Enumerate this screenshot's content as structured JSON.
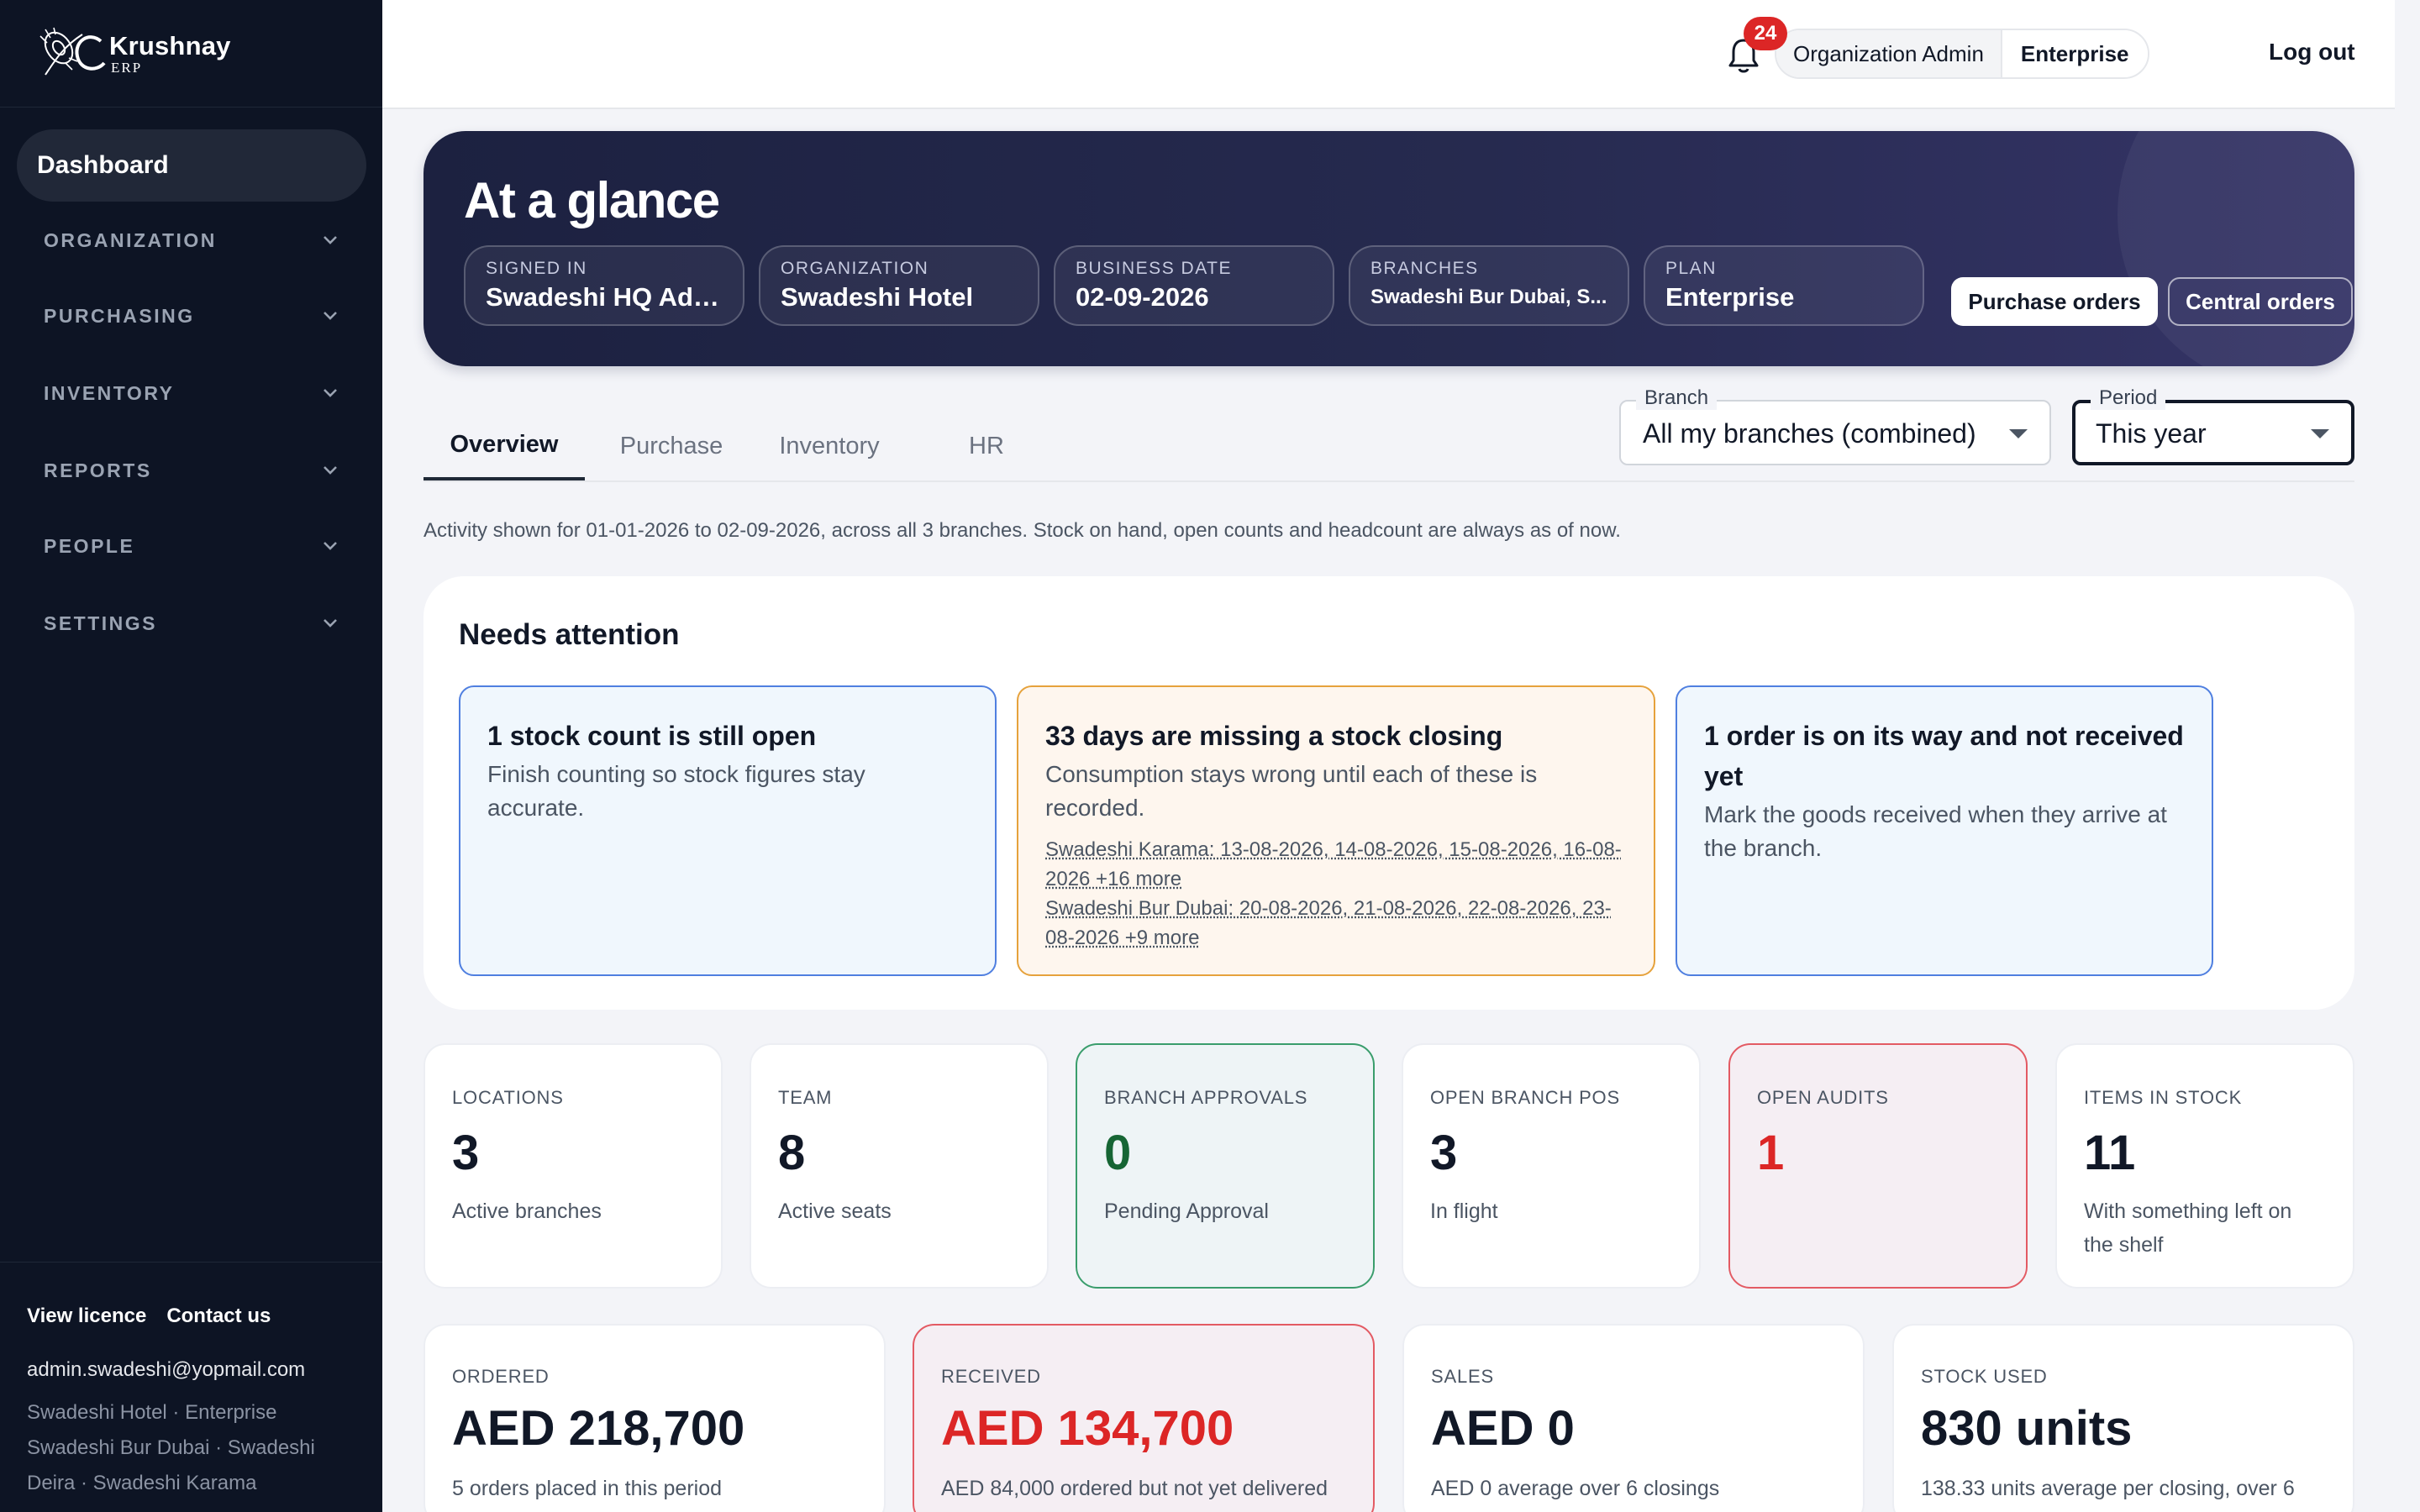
{
  "brand": {
    "name": "Krushnay",
    "sub": "ERP",
    "logo_icon": "peacock-feather-logo-icon"
  },
  "sidebar": {
    "active": "Dashboard",
    "items": [
      {
        "label": "ORGANIZATION"
      },
      {
        "label": "PURCHASING"
      },
      {
        "label": "INVENTORY"
      },
      {
        "label": "REPORTS"
      },
      {
        "label": "PEOPLE"
      },
      {
        "label": "SETTINGS"
      }
    ],
    "footer": {
      "view_licence": "View licence",
      "contact_us": "Contact us",
      "email": "admin.swadeshi@yopmail.com",
      "org_line1": "Swadeshi Hotel · Enterprise",
      "org_line2": "Swadeshi Bur Dubai · Swadeshi",
      "org_line3": "Deira · Swadeshi Karama"
    }
  },
  "topbar": {
    "role": "Organization Admin",
    "plan": "Enterprise",
    "notifications": "24",
    "logout": "Log out"
  },
  "hero": {
    "title": "At a glance",
    "chips": [
      {
        "label": "SIGNED IN",
        "value": "Swadeshi HQ Admin"
      },
      {
        "label": "ORGANIZATION",
        "value": "Swadeshi Hotel"
      },
      {
        "label": "BUSINESS DATE",
        "value": "02-09-2026"
      },
      {
        "label": "BRANCHES",
        "value": "Swadeshi Bur Dubai, S..."
      },
      {
        "label": "PLAN",
        "value": "Enterprise"
      }
    ],
    "purchase_orders": "Purchase orders",
    "central_orders": "Central orders"
  },
  "tabs": [
    "Overview",
    "Purchase",
    "Inventory",
    "HR"
  ],
  "filters": {
    "branch_label": "Branch",
    "branch_value": "All my branches (combined)",
    "period_label": "Period",
    "period_value": "This year"
  },
  "activity_note": "Activity shown for 01-01-2026 to 02-09-2026, across all 3 branches. Stock on hand, open counts and headcount are always as of now.",
  "attention": {
    "title": "Needs attention",
    "cards": [
      {
        "title": "1 stock count is still open",
        "body": "Finish counting so stock figures stay accurate."
      },
      {
        "title": "33 days are missing a stock closing",
        "body": "Consumption stays wrong until each of these is recorded.",
        "links": [
          "Swadeshi Karama: 13-08-2026, 14-08-2026, 15-08-2026, 16-08-2026 +16 more",
          "Swadeshi Bur Dubai: 20-08-2026, 21-08-2026, 22-08-2026, 23-08-2026 +9 more"
        ]
      },
      {
        "title": "1 order is on its way and not received yet",
        "body": "Mark the goods received when they arrive at the branch."
      }
    ]
  },
  "stats": [
    {
      "label": "LOCATIONS",
      "value": "3",
      "sub": "Active branches"
    },
    {
      "label": "TEAM",
      "value": "8",
      "sub": "Active seats"
    },
    {
      "label": "BRANCH APPROVALS",
      "value": "0",
      "sub": "Pending Approval"
    },
    {
      "label": "OPEN BRANCH POS",
      "value": "3",
      "sub": "In flight"
    },
    {
      "label": "OPEN AUDITS",
      "value": "1",
      "sub": ""
    },
    {
      "label": "ITEMS IN STOCK",
      "value": "11",
      "sub": "With something left on the shelf"
    }
  ],
  "money": [
    {
      "label": "ORDERED",
      "value": "AED 218,700",
      "sub": "5 orders placed in this period"
    },
    {
      "label": "RECEIVED",
      "value": "AED 134,700",
      "sub": "AED 84,000 ordered but not yet delivered"
    },
    {
      "label": "SALES",
      "value": "AED 0",
      "sub": "AED 0 average over 6 closings"
    },
    {
      "label": "STOCK USED",
      "value": "830 units",
      "sub": "138.33 units average per closing, over 6"
    }
  ]
}
